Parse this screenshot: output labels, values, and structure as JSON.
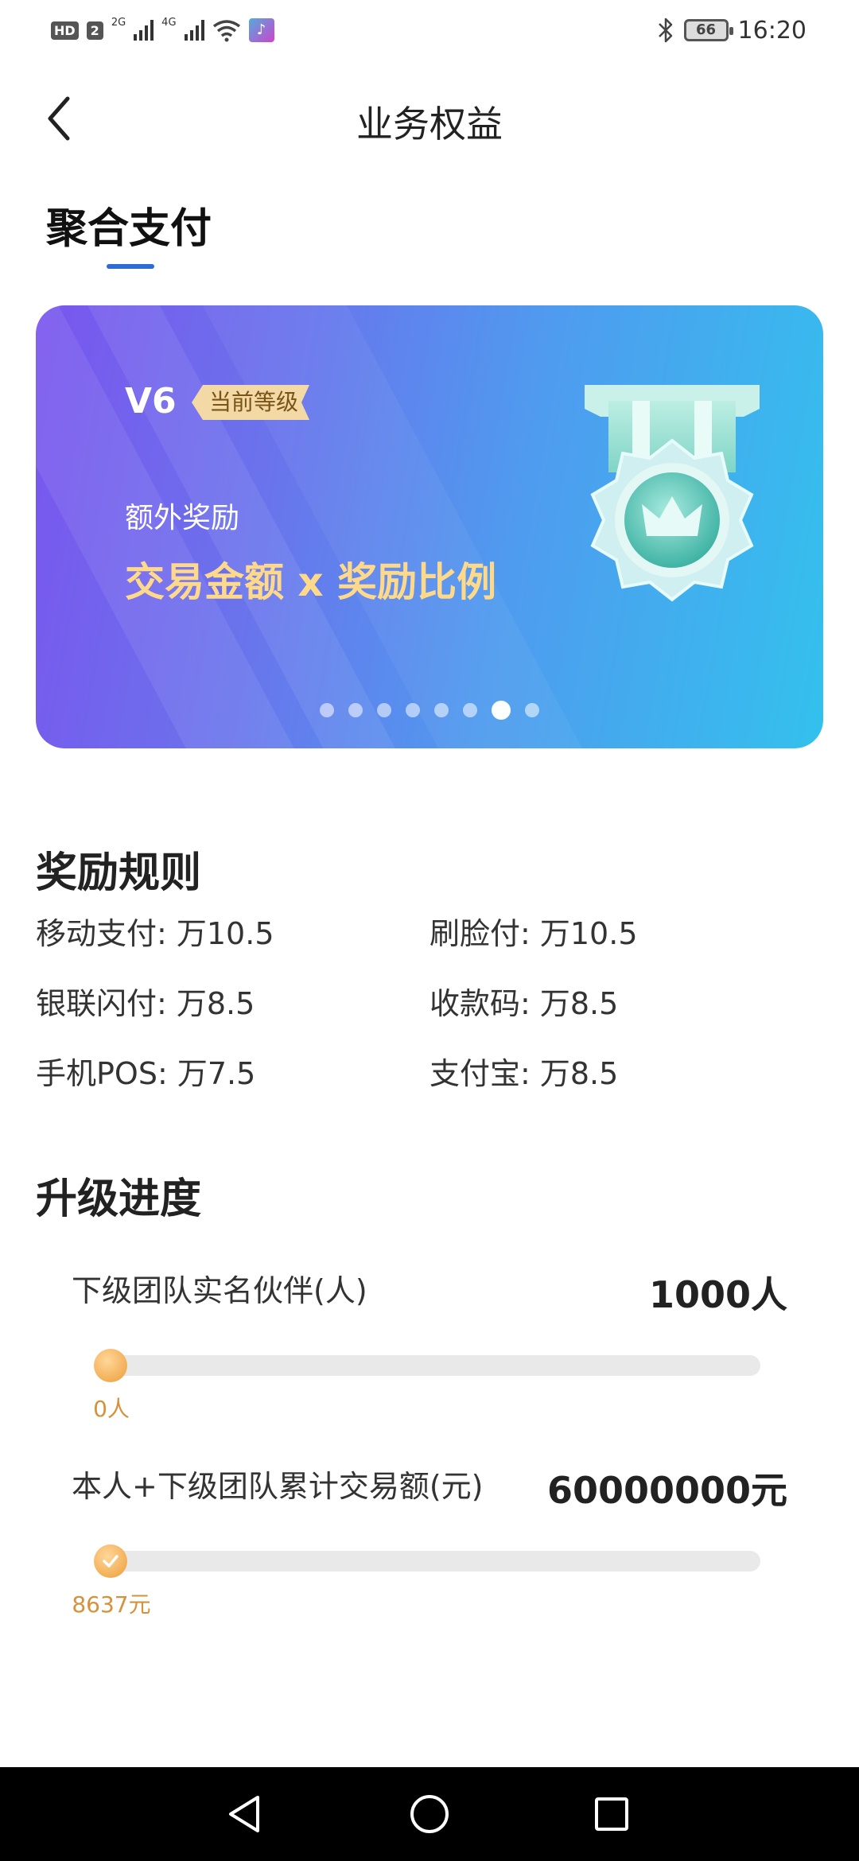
{
  "status_bar": {
    "hd": "HD",
    "sim": "2",
    "net1": "2G",
    "net2": "4G",
    "battery": "66",
    "time": "16:20"
  },
  "header": {
    "title": "业务权益"
  },
  "section_tab": "聚合支付",
  "banner": {
    "level": "V6",
    "level_tag": "当前等级",
    "bonus_label": "额外奖励",
    "bonus_formula": "交易金额 x 奖励比例",
    "page_count": 8,
    "active_page": 7
  },
  "rules": {
    "title": "奖励规则",
    "items": [
      "移动支付: 万10.5",
      "刷脸付: 万10.5",
      "银联闪付: 万8.5",
      "收款码: 万8.5",
      "手机POS: 万7.5",
      "支付宝: 万8.5"
    ]
  },
  "upgrade": {
    "title": "升级进度",
    "items": [
      {
        "label": "下级团队实名伙伴(人)",
        "target": "1000人",
        "current": "0人",
        "progress": 0
      },
      {
        "label": "本人+下级团队累计交易额(元)",
        "target": "60000000元",
        "current": "8637元",
        "progress": 0.0001
      }
    ]
  },
  "colors": {
    "accent": "#2d6bd6",
    "gold": "#ffd98a",
    "progress": "#f1a84b"
  }
}
